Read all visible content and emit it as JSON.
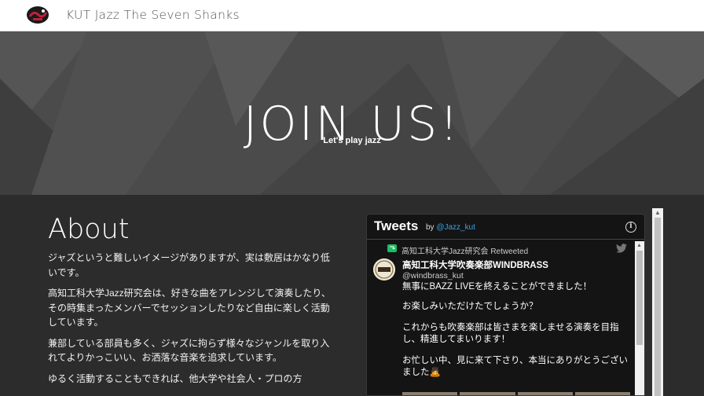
{
  "header": {
    "site_title": "KUT Jazz The Seven Shanks",
    "logo_icon": "jazz-logo-icon"
  },
  "hero": {
    "title": "JOIN US!",
    "subtitle": "Let's play jazz"
  },
  "about": {
    "heading": "About",
    "paragraphs": [
      "ジャズというと難しいイメージがありますが、実は敷居はかなり低いです。",
      "高知工科大学Jazz研究会は、好きな曲をアレンジして演奏したり、その時集まったメンバーでセッションしたりなど自由に楽しく活動しています。",
      "兼部している部員も多く、ジャズに拘らず様々なジャンルを取り入れてよりかっこいい、お洒落な音楽を追求しています。",
      "ゆるく活動することもできれば、他大学や社会人・プロの方"
    ]
  },
  "twitter": {
    "title": "Tweets",
    "by_prefix": "by",
    "by_handle": "@Jazz_kut",
    "retweet_line": "高知工科大学Jazz研究会 Retweeted",
    "author_name": "高知工科大学吹奏楽部WINDBRASS",
    "author_handle": "@windbrass_kut",
    "avatar_text": "WIND BRASS",
    "tweet_lines": [
      "無事にBAZZ LIVEを終えることができました！",
      "お楽しみいただけたでしょうか？",
      "これからも吹奏楽部は皆さまを楽しませる演奏を目指し、精進してまいります！",
      "お忙しい中、見に来て下さり、本当にありがとうございました🙇"
    ],
    "info_symbol": "i"
  },
  "colors": {
    "header_bg": "#ffffff",
    "hero_bg": "#4a4a4a",
    "main_bg": "#2c2c2c",
    "widget_bg": "#141414",
    "link_blue": "#3aa0e8",
    "retweet_green": "#17bf63"
  }
}
